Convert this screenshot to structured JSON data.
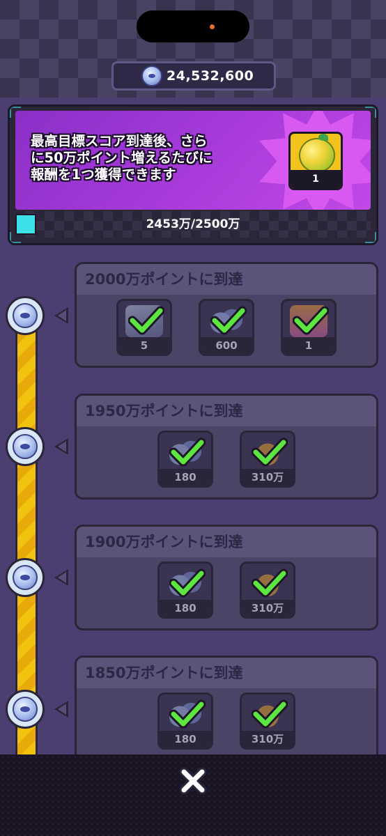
{
  "currency": {
    "icon": "fish-coin-icon",
    "amount": "24,532,600"
  },
  "banner": {
    "lines": [
      "最高目標スコア到達後、さら",
      "に50万ポイント増えるたびに",
      "報酬を1つ獲得できます"
    ],
    "reward": {
      "icon": "star-fruit-icon",
      "count": "1"
    },
    "progress": {
      "text": "2453万/2500万",
      "fraction": 0.02
    }
  },
  "milestones": [
    {
      "title": "2000万ポイントに到達",
      "items": [
        {
          "icon": "item-box-icon",
          "qty": "5",
          "claimed": true
        },
        {
          "icon": "fish-coins-icon",
          "qty": "600",
          "claimed": true
        },
        {
          "icon": "card-pack-icon",
          "qty": "1",
          "claimed": true
        }
      ]
    },
    {
      "title": "1950万ポイントに到達",
      "items": [
        {
          "icon": "fish-coins-icon",
          "qty": "180",
          "claimed": true
        },
        {
          "icon": "gold-coins-icon",
          "qty": "310万",
          "claimed": true
        }
      ]
    },
    {
      "title": "1900万ポイントに到達",
      "items": [
        {
          "icon": "fish-coins-icon",
          "qty": "180",
          "claimed": true
        },
        {
          "icon": "gold-coins-icon",
          "qty": "310万",
          "claimed": true
        }
      ]
    },
    {
      "title": "1850万ポイントに到達",
      "items": [
        {
          "icon": "fish-coins-icon",
          "qty": "180",
          "claimed": true
        },
        {
          "icon": "gold-coins-icon",
          "qty": "310万",
          "claimed": true
        }
      ]
    }
  ],
  "colors": {
    "accent_green": "#5de640",
    "progress_cyan": "#3ee0e8",
    "banner_purple": "#a63ad9",
    "rail_yellow": "#f1c20e"
  },
  "close_icon": "close-x-icon"
}
